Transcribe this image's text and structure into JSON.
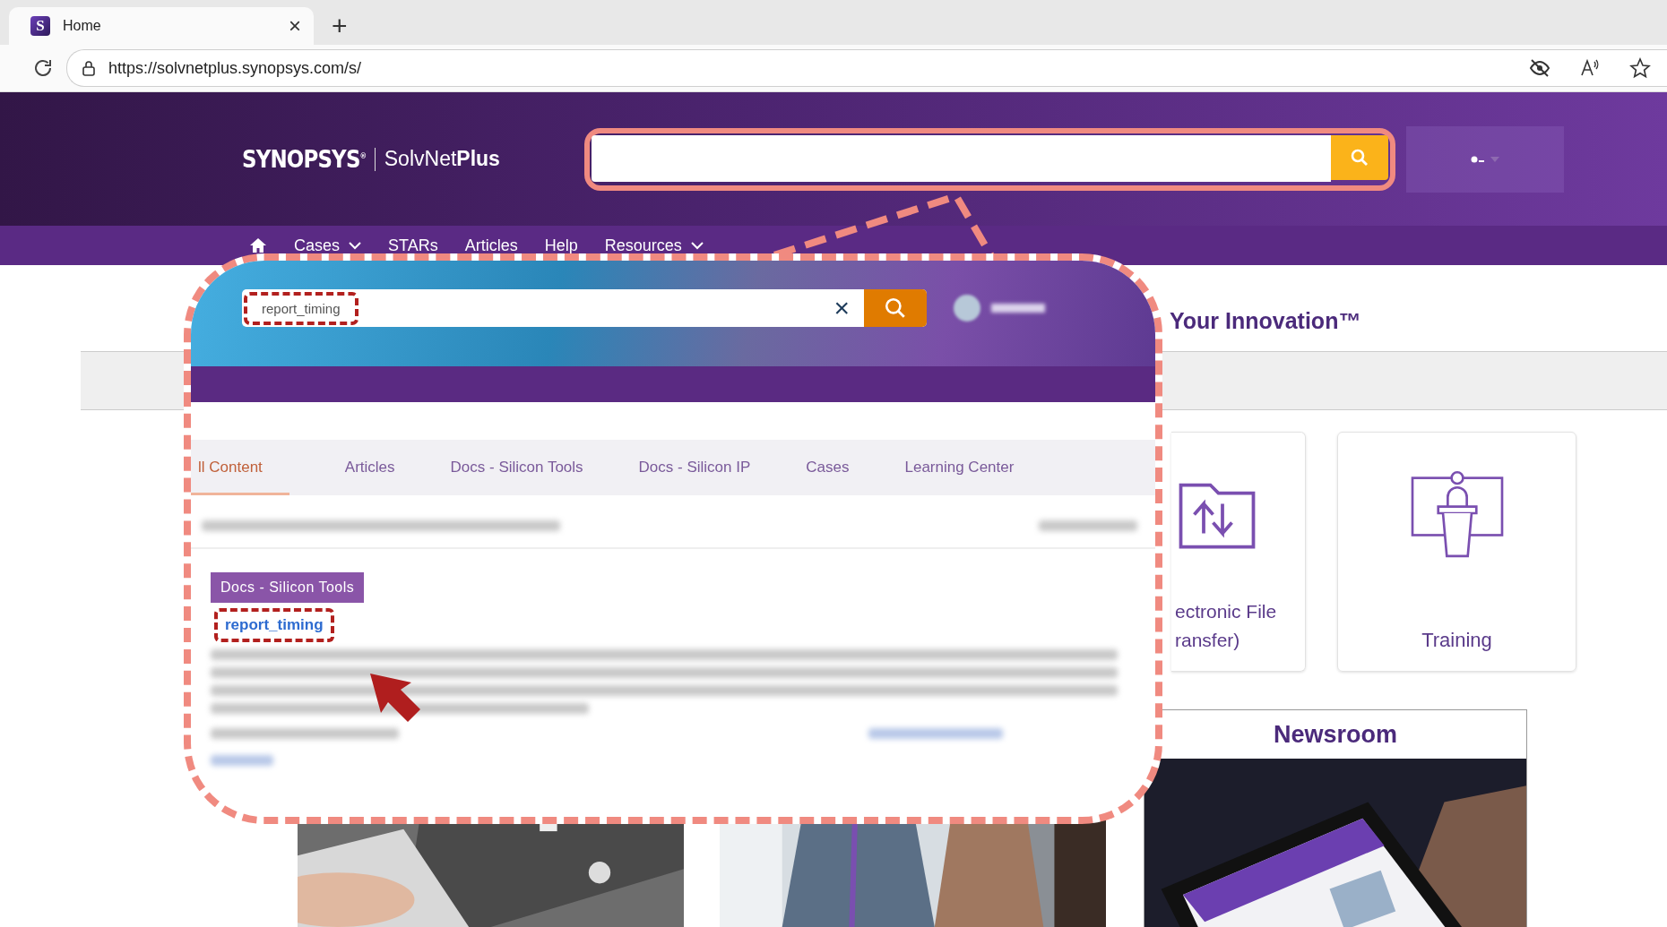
{
  "browser": {
    "tab": {
      "favicon": "S",
      "title": "Home",
      "close": "×",
      "selected": true
    },
    "new_tab": "+",
    "url": "https://solvnetplus.synopsys.com/s/"
  },
  "header": {
    "logo": "SYNOPSYS",
    "logo_mark": "®",
    "product": "SolvNet**Plus**",
    "search_highlighted": true
  },
  "nav": [
    {
      "label": "Cases",
      "dropdown": true
    },
    {
      "label": "STARs",
      "dropdown": false
    },
    {
      "label": "Articles",
      "dropdown": false
    },
    {
      "label": "Help",
      "dropdown": false
    },
    {
      "label": "Resources",
      "dropdown": true
    }
  ],
  "page": {
    "title": "Your Innovation™",
    "cards": [
      {
        "lines": [
          "ectronic File",
          "ransfer)"
        ]
      },
      {
        "lines": [
          "Training"
        ]
      }
    ],
    "newsroom": {
      "title": "Newsroom"
    }
  },
  "callout": {
    "search": {
      "value": "report_timing",
      "clear": "×",
      "highlighted": true
    },
    "tabs": [
      {
        "label": "ll Content",
        "selected": true
      },
      {
        "label": "Articles",
        "selected": false
      },
      {
        "label": "Docs - Silicon Tools",
        "selected": false
      },
      {
        "label": "Docs - Silicon IP",
        "selected": false
      },
      {
        "label": "Cases",
        "selected": false
      },
      {
        "label": "Learning Center",
        "selected": false
      }
    ],
    "result": {
      "tag": "Docs - Silicon Tools",
      "title": "report_timing",
      "highlighted": true
    }
  }
}
